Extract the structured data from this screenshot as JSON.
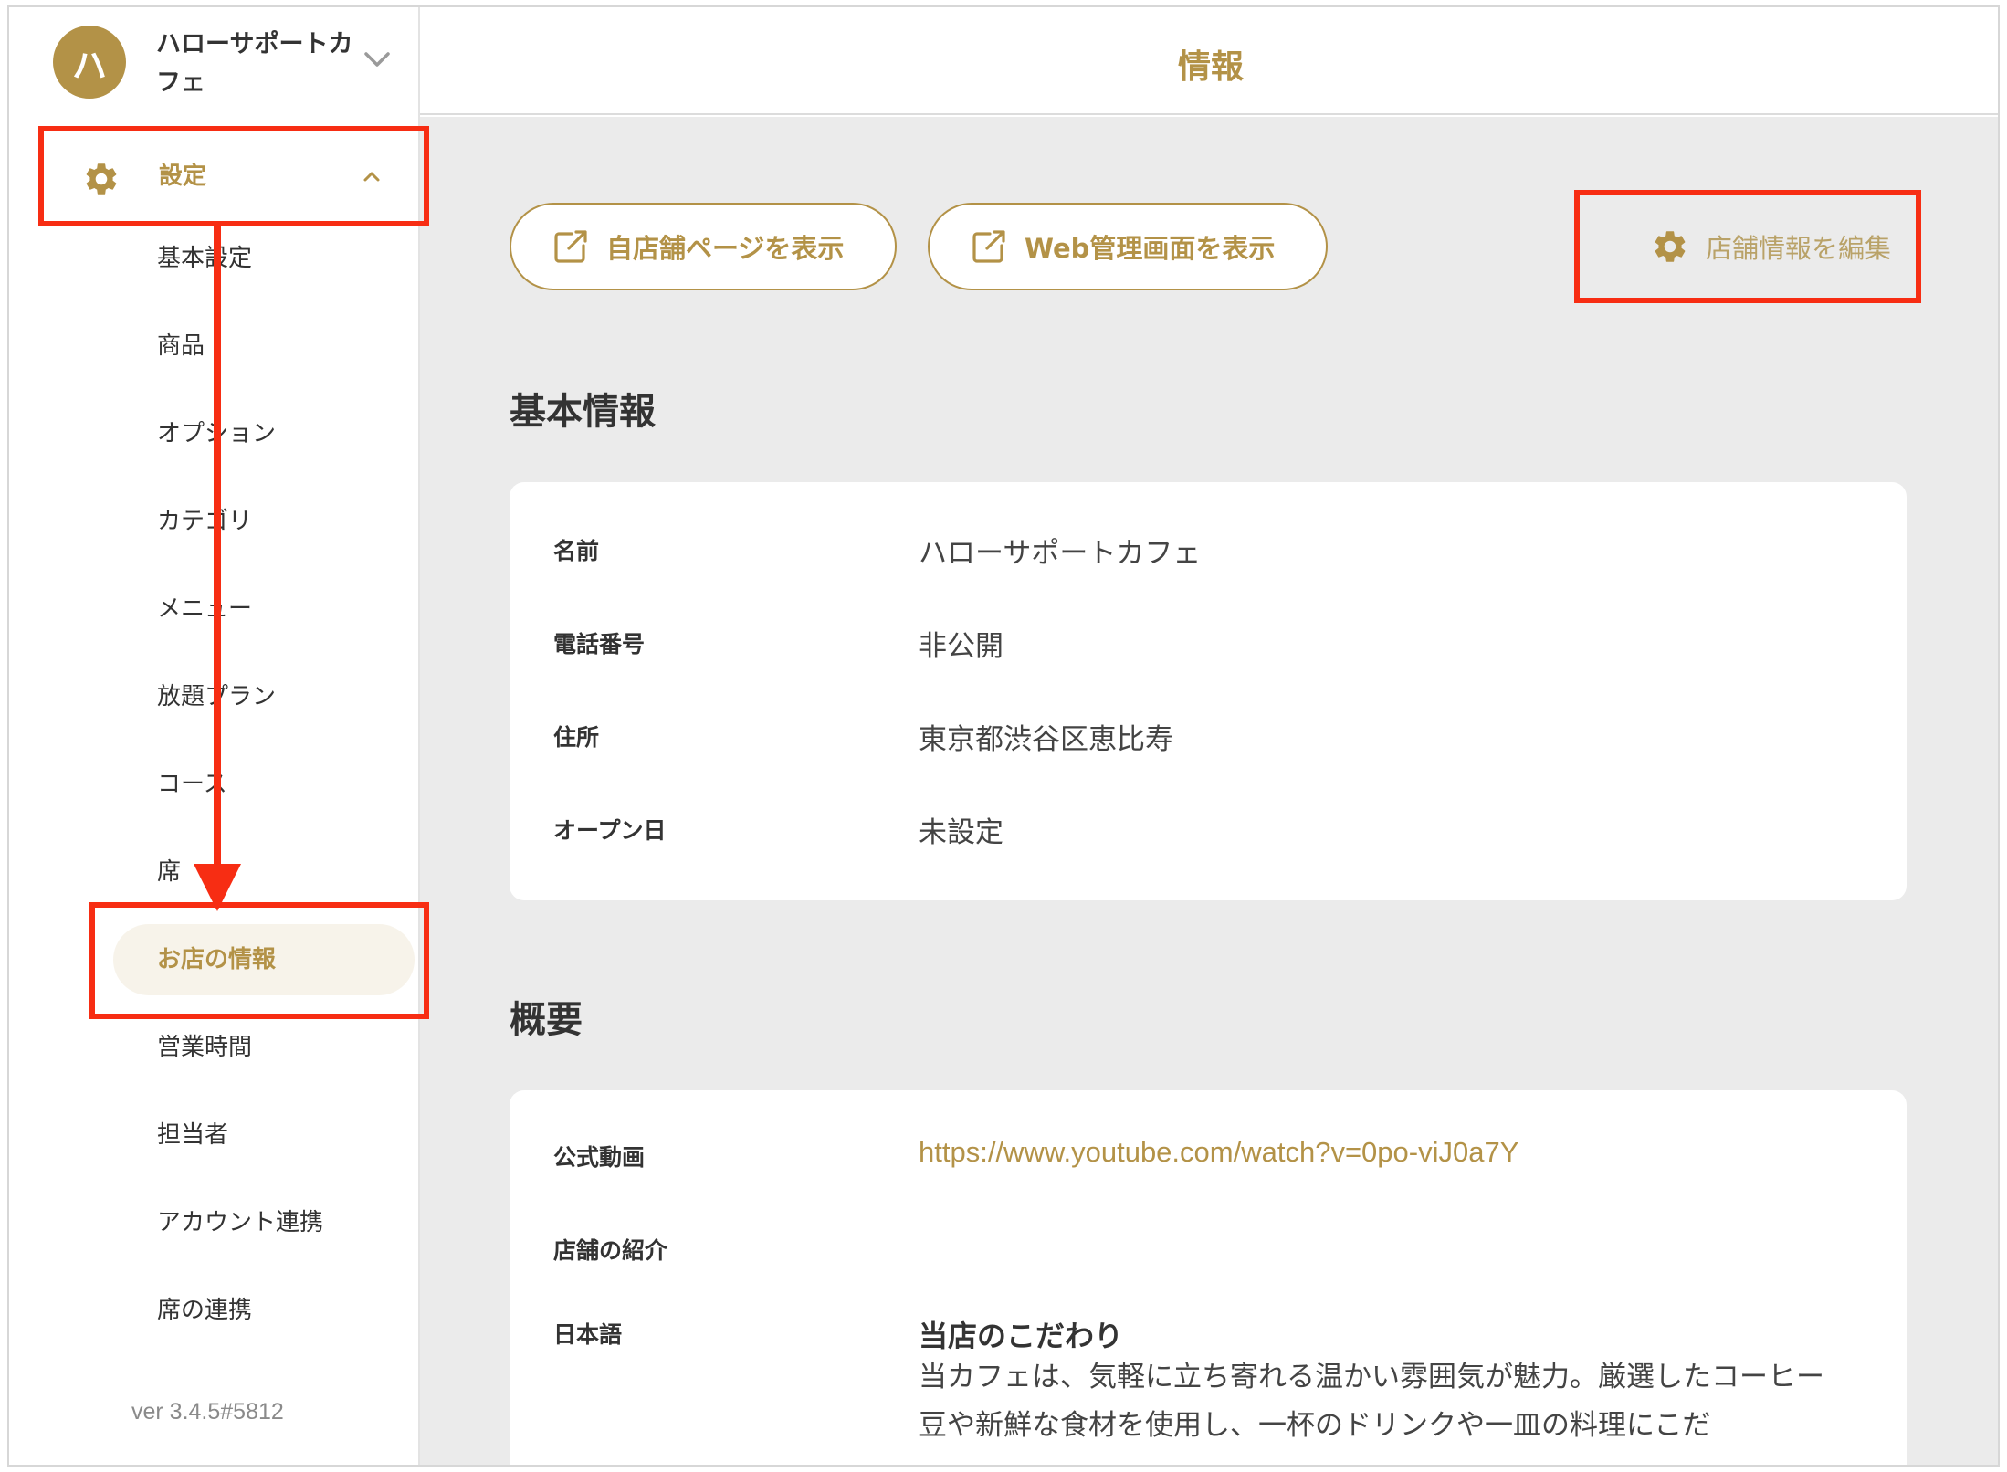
{
  "store": {
    "avatar_initial": "ハ",
    "name": "ハローサポートカフェ"
  },
  "sidebar": {
    "settings_label": "設定",
    "items": [
      {
        "label": "基本設定",
        "active": false
      },
      {
        "label": "商品",
        "active": false
      },
      {
        "label": "オプション",
        "active": false
      },
      {
        "label": "カテゴリ",
        "active": false
      },
      {
        "label": "メニュー",
        "active": false
      },
      {
        "label": "放題プラン",
        "active": false
      },
      {
        "label": "コース",
        "active": false
      },
      {
        "label": "席",
        "active": false
      },
      {
        "label": "お店の情報",
        "active": true
      },
      {
        "label": "営業時間",
        "active": false
      },
      {
        "label": "担当者",
        "active": false
      },
      {
        "label": "アカウント連携",
        "active": false
      },
      {
        "label": "席の連携",
        "active": false
      }
    ],
    "version": "ver 3.4.5#5812"
  },
  "header": {
    "title": "情報"
  },
  "actions": {
    "store_page": "自店舗ページを表示",
    "web_admin": "Web管理画面を表示",
    "edit_store": "店舗情報を編集"
  },
  "basic_info": {
    "title": "基本情報",
    "rows": [
      {
        "label": "名前",
        "value": "ハローサポートカフェ"
      },
      {
        "label": "電話番号",
        "value": "非公開"
      },
      {
        "label": "住所",
        "value": "東京都渋谷区恵比寿"
      },
      {
        "label": "オープン日",
        "value": "未設定"
      }
    ]
  },
  "overview": {
    "title": "概要",
    "video_label": "公式動画",
    "video_url": "https://www.youtube.com/watch?v=0po-viJ0a7Y",
    "intro_label": "店舗の紹介",
    "lang_label": "日本語",
    "heading": "当店のこだわり",
    "text": "当カフェは、気軽に立ち寄れる温かい雰囲気が魅力。厳選したコーヒー豆や新鮮な食材を使用し、一杯のドリンクや一皿の料理にこだ"
  },
  "colors": {
    "accent": "#b39247",
    "annotation": "#f72d13",
    "background": "#ebebeb"
  }
}
